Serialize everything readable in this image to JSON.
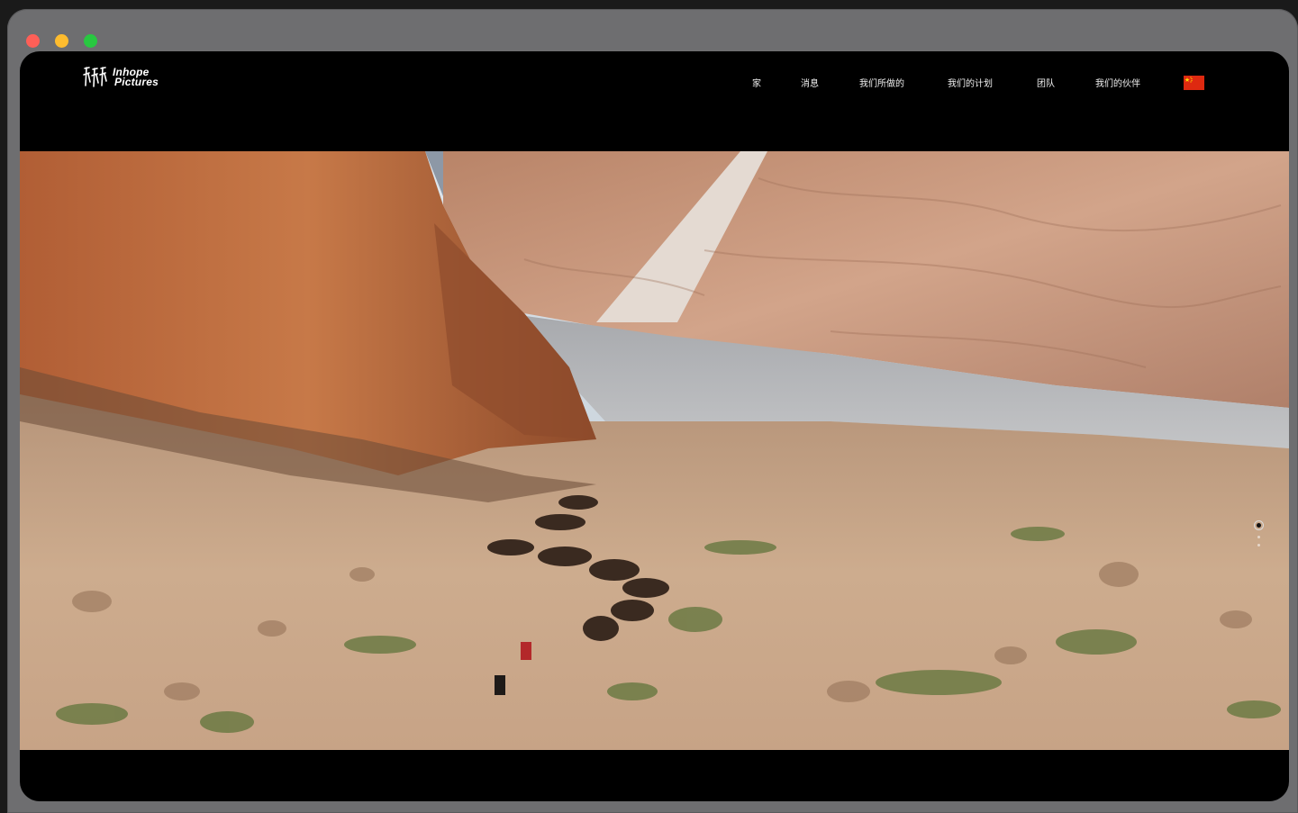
{
  "window": {
    "controls": [
      "close",
      "minimize",
      "maximize"
    ]
  },
  "brand": {
    "line1": "Inhope",
    "line2": "Pictures"
  },
  "nav": {
    "items": [
      {
        "label": "家"
      },
      {
        "label": "消息"
      },
      {
        "label": "我们所做的"
      },
      {
        "label": "我们的计划"
      },
      {
        "label": "团队"
      },
      {
        "label": "我们的伙伴"
      }
    ],
    "language_flag": "china-flag-icon"
  },
  "hero": {
    "scene": "photo-camel-caravan-valley",
    "slides": {
      "count": 3,
      "active": 1
    }
  },
  "colors": {
    "background": "#000000",
    "window_frame": "#6e6e70",
    "flag_red": "#de2910",
    "flag_star": "#ffde00"
  }
}
